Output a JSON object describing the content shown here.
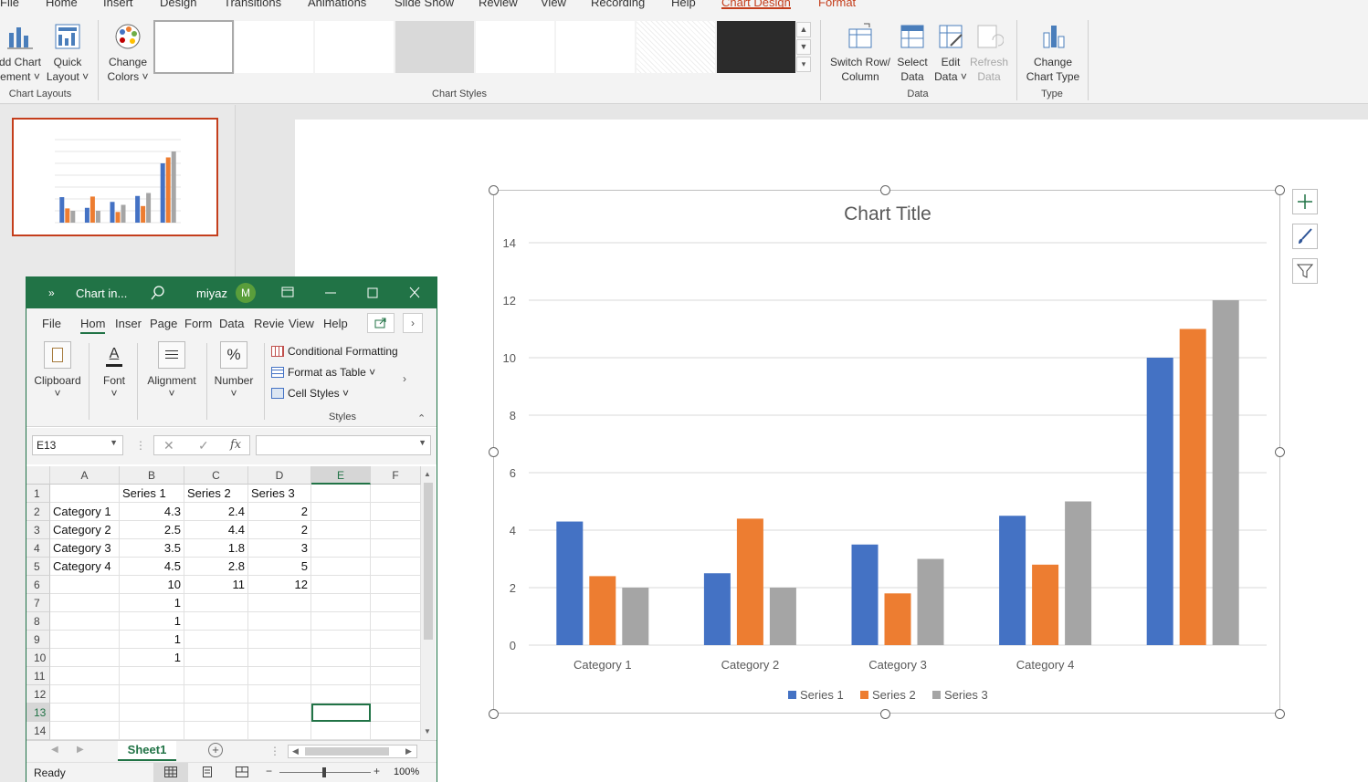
{
  "ribbon": {
    "tabs": [
      "File",
      "Home",
      "Insert",
      "Design",
      "Transitions",
      "Animations",
      "Slide Show",
      "Review",
      "View",
      "Recording",
      "Help",
      "Chart Design",
      "Format"
    ],
    "add_chart_element": [
      "dd Chart",
      "ement"
    ],
    "quick_layout": [
      "Quick",
      "Layout"
    ],
    "change_colors": [
      "Change",
      "Colors"
    ],
    "switch_row_col": [
      "Switch Row/",
      "Column"
    ],
    "select_data": [
      "Select",
      "Data"
    ],
    "edit_data": [
      "Edit",
      "Data"
    ],
    "refresh_data": [
      "Refresh",
      "Data"
    ],
    "change_chart_type": [
      "Change",
      "Chart Type"
    ],
    "group_labels": {
      "chart_layouts": "Chart Layouts",
      "chart_styles": "Chart Styles",
      "data": "Data",
      "type": "Type"
    }
  },
  "chart": {
    "colors": {
      "series1": "#4472c4",
      "series2": "#ed7d31",
      "series3": "#a5a5a5",
      "accent": "#c43e1c"
    }
  },
  "chart_data": {
    "type": "bar",
    "title": "Chart Title",
    "categories": [
      "Category 1",
      "Category 2",
      "Category 3",
      "Category 4",
      ""
    ],
    "series": [
      {
        "name": "Series 1",
        "values": [
          4.3,
          2.5,
          3.5,
          4.5,
          10
        ]
      },
      {
        "name": "Series 2",
        "values": [
          2.4,
          4.4,
          1.8,
          2.8,
          11
        ]
      },
      {
        "name": "Series 3",
        "values": [
          2,
          2,
          3,
          5,
          12
        ]
      }
    ],
    "ylim": [
      0,
      14
    ],
    "yticks": [
      0,
      2,
      4,
      6,
      8,
      10,
      12,
      14
    ],
    "grid": true,
    "legend": "bottom"
  },
  "excel": {
    "title": "Chart in...",
    "user": "miyaz",
    "avatar": "M",
    "tabs": [
      "File",
      "Hom",
      "Inser",
      "Page",
      "Form",
      "Data",
      "Revie",
      "View",
      "Help"
    ],
    "groups": {
      "clipboard": "Clipboard",
      "font": "Font",
      "alignment": "Alignment",
      "number": "Number",
      "styles": "Styles"
    },
    "styles_items": [
      "Conditional Formatting",
      "Format as Table",
      "Cell Styles"
    ],
    "name_box": "E13",
    "columns": [
      "A",
      "B",
      "C",
      "D",
      "E",
      "F"
    ],
    "rows": [
      [
        "",
        "Series 1",
        "Series 2",
        "Series 3",
        "",
        ""
      ],
      [
        "Category 1",
        "4.3",
        "2.4",
        "2",
        "",
        ""
      ],
      [
        "Category 2",
        "2.5",
        "4.4",
        "2",
        "",
        ""
      ],
      [
        "Category 3",
        "3.5",
        "1.8",
        "3",
        "",
        ""
      ],
      [
        "Category 4",
        "4.5",
        "2.8",
        "5",
        "",
        ""
      ],
      [
        "",
        "10",
        "11",
        "12",
        "",
        ""
      ],
      [
        "",
        "1",
        "",
        "",
        "",
        ""
      ],
      [
        "",
        "1",
        "",
        "",
        "",
        ""
      ],
      [
        "",
        "1",
        "",
        "",
        "",
        ""
      ],
      [
        "",
        "1",
        "",
        "",
        "",
        ""
      ],
      [
        "",
        "",
        "",
        "",
        "",
        ""
      ],
      [
        "",
        "",
        "",
        "",
        "",
        ""
      ],
      [
        "",
        "",
        "",
        "",
        "",
        ""
      ],
      [
        "",
        "",
        "",
        "",
        "",
        ""
      ]
    ],
    "sheet_tab": "Sheet1",
    "status": "Ready",
    "zoom": "100%"
  }
}
